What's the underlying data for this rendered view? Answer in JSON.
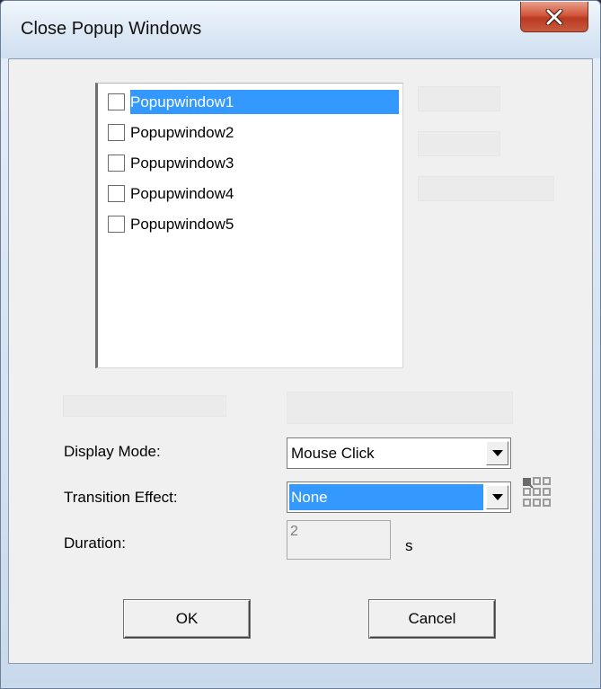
{
  "window": {
    "title": "Close Popup Windows"
  },
  "list": {
    "items": [
      {
        "label": "Popupwindow1",
        "checked": false,
        "selected": true
      },
      {
        "label": "Popupwindow2",
        "checked": false,
        "selected": false
      },
      {
        "label": "Popupwindow3",
        "checked": false,
        "selected": false
      },
      {
        "label": "Popupwindow4",
        "checked": false,
        "selected": false
      },
      {
        "label": "Popupwindow5",
        "checked": false,
        "selected": false
      }
    ]
  },
  "form": {
    "display_mode_label": "Display Mode:",
    "display_mode_value": "Mouse Click",
    "transition_label": "Transition Effect:",
    "transition_value": "None",
    "duration_label": "Duration:",
    "duration_value": "2",
    "duration_unit": "s"
  },
  "buttons": {
    "ok": "OK",
    "cancel": "Cancel"
  },
  "colors": {
    "selection": "#3399ff",
    "close_button": "#c94a30",
    "dialog_background": "#f0f0f0"
  },
  "icons": {
    "close": "close-icon",
    "transition_settings": "grid-settings-icon",
    "dropdown": "dropdown-arrow-icon"
  }
}
